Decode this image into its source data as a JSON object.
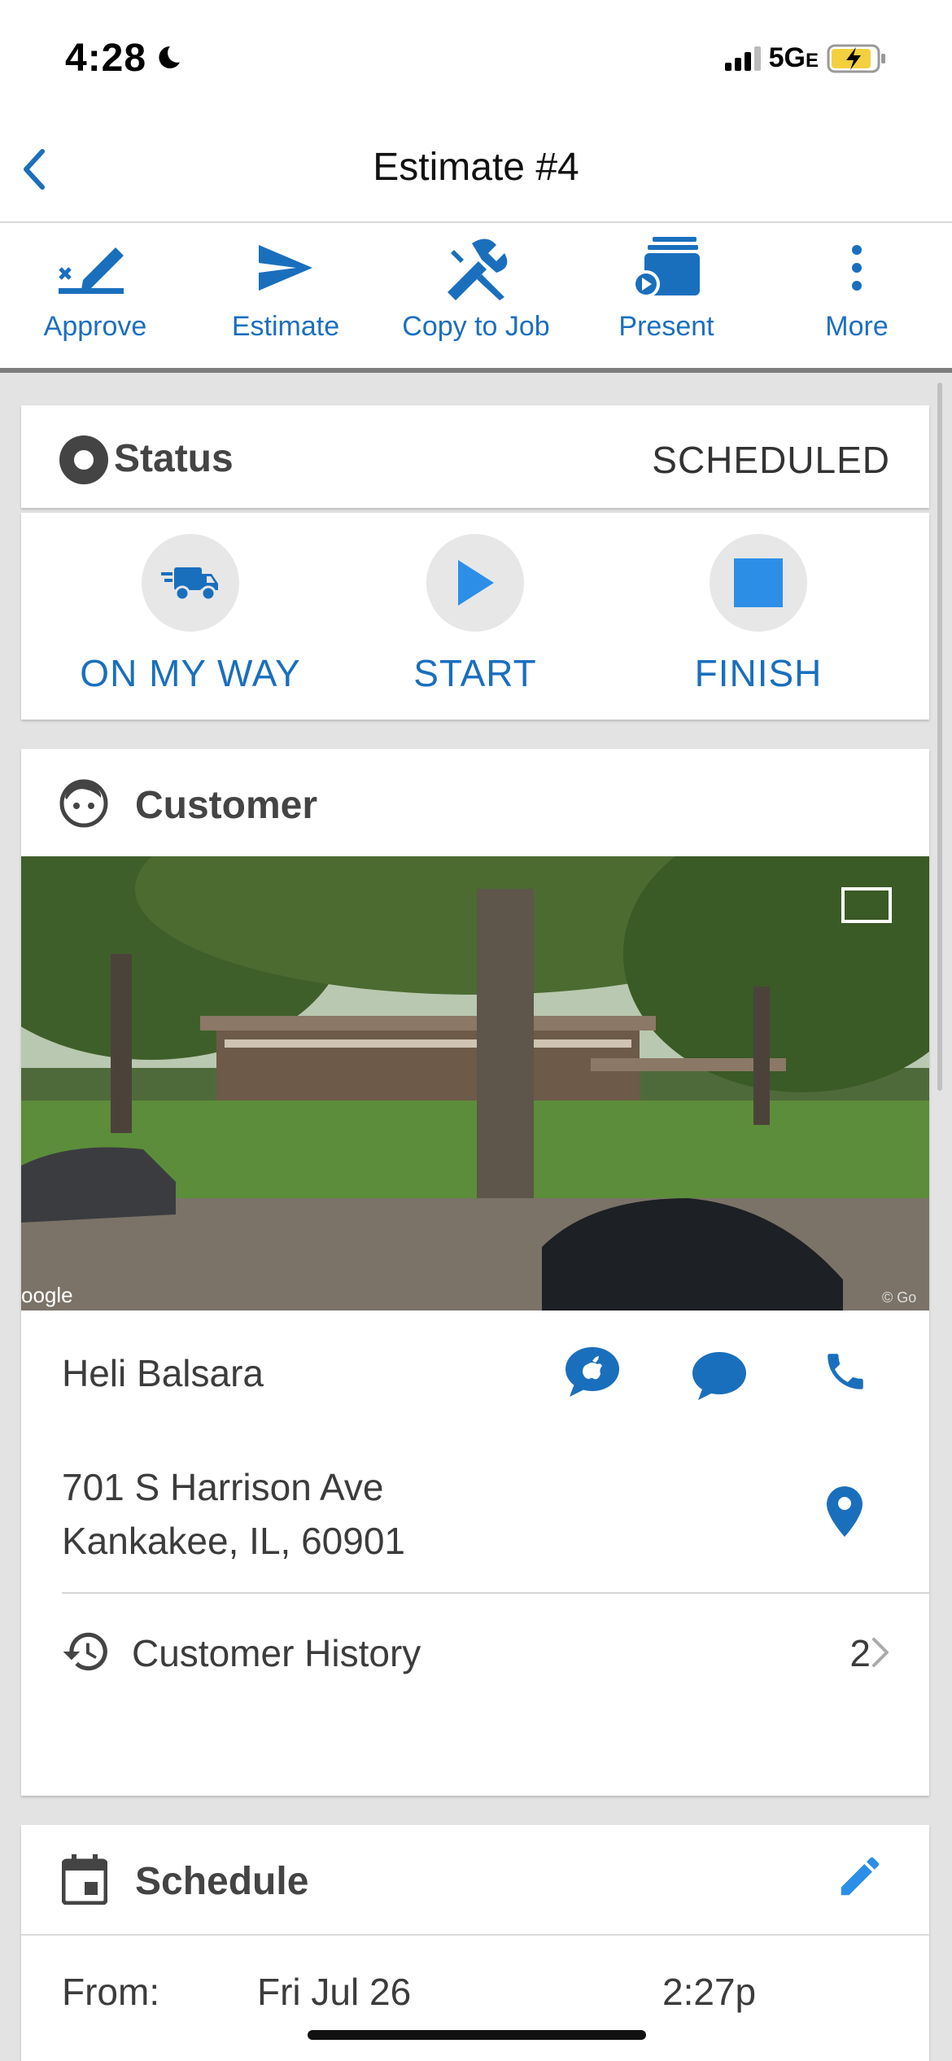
{
  "statusbar": {
    "time": "4:28",
    "network": "5G",
    "network_sub": "E"
  },
  "nav": {
    "title": "Estimate #4"
  },
  "toolbar": [
    {
      "label": "Approve",
      "icon": "approve-signature-icon"
    },
    {
      "label": "Estimate",
      "icon": "send-icon"
    },
    {
      "label": "Copy to Job",
      "icon": "tools-icon"
    },
    {
      "label": "Present",
      "icon": "present-icon"
    },
    {
      "label": "More",
      "icon": "more-vertical-icon"
    }
  ],
  "status": {
    "title": "Status",
    "value": "SCHEDULED",
    "actions": [
      {
        "label": "ON MY WAY",
        "icon": "truck-icon"
      },
      {
        "label": "START",
        "icon": "play-icon"
      },
      {
        "label": "FINISH",
        "icon": "stop-icon"
      }
    ]
  },
  "customer": {
    "title": "Customer",
    "photo_watermark_left": "oogle",
    "photo_watermark_right": "© Go",
    "name": "Heli Balsara",
    "address_line1": "701 S Harrison Ave",
    "address_line2": "Kankakee, IL, 60901",
    "history_label": "Customer History",
    "history_count": "2"
  },
  "schedule": {
    "title": "Schedule",
    "from_label": "From:",
    "from_date": "Fri Jul 26",
    "from_time": "2:27p"
  },
  "colors": {
    "accent": "#1a6fbd",
    "background": "#e3e3e3",
    "battery": "#f4d03f"
  }
}
